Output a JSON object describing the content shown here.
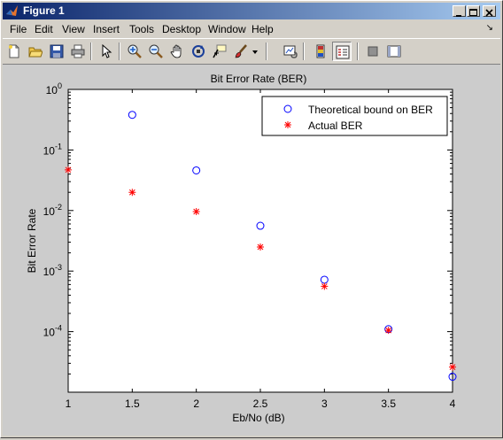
{
  "window": {
    "title": "Figure 1"
  },
  "menu": [
    "File",
    "Edit",
    "View",
    "Insert",
    "Tools",
    "Desktop",
    "Window",
    "Help"
  ],
  "menu_arrow": "↘",
  "toolbar_icons": [
    "new-figure-icon",
    "open-file-icon",
    "save-icon",
    "print-icon",
    "select-arrow-icon",
    "zoom-in-icon",
    "zoom-out-icon",
    "pan-hand-icon",
    "rotate-3d-icon",
    "data-cursor-icon",
    "brush-icon",
    "link-plot-icon",
    "colorbar-icon",
    "legend-icon",
    "hide-plot-tools-icon",
    "show-plot-tools-icon"
  ],
  "chart_data": {
    "type": "scatter",
    "title": "Bit Error Rate (BER)",
    "xlabel": "Eb/No (dB)",
    "ylabel": "Bit Error Rate",
    "xlim": [
      1,
      4
    ],
    "ylim": [
      1e-05,
      1
    ],
    "yscale": "log",
    "x_ticks": [
      "1",
      "1.5",
      "2",
      "2.5",
      "3",
      "3.5",
      "4"
    ],
    "y_ticks": [
      {
        "base": "10",
        "exp": "0"
      },
      {
        "base": "10",
        "exp": "-1"
      },
      {
        "base": "10",
        "exp": "-2"
      },
      {
        "base": "10",
        "exp": "-3"
      },
      {
        "base": "10",
        "exp": "-4"
      }
    ],
    "legend_position": "top-right",
    "series": [
      {
        "name": "Theoretical bound on BER",
        "marker": "circle",
        "color": "#0000ff",
        "x": [
          1.5,
          2,
          2.5,
          3,
          3.5,
          4
        ],
        "y": [
          0.38,
          0.046,
          0.0056,
          0.00072,
          0.00011,
          1.8e-05
        ]
      },
      {
        "name": "Actual BER",
        "marker": "star",
        "color": "#ff0000",
        "x": [
          1,
          1.5,
          2,
          2.5,
          3,
          3.5,
          4
        ],
        "y": [
          0.047,
          0.02,
          0.0096,
          0.0025,
          0.00056,
          0.000105,
          2.6e-05
        ]
      }
    ]
  }
}
